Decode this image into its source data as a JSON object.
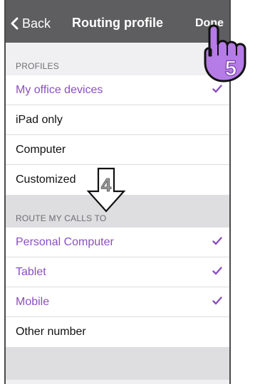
{
  "nav": {
    "back_label": "Back",
    "title": "Routing profile",
    "done_label": "Done"
  },
  "profiles": {
    "header": "PROFILES",
    "items": [
      {
        "label": "My office devices",
        "selected": true
      },
      {
        "label": "iPad only",
        "selected": false
      },
      {
        "label": "Computer",
        "selected": false
      },
      {
        "label": "Customized",
        "selected": false
      }
    ]
  },
  "route_calls": {
    "header": "ROUTE MY CALLS TO",
    "items": [
      {
        "label": "Personal Computer",
        "checked": true
      },
      {
        "label": "Tablet",
        "checked": true
      },
      {
        "label": "Mobile",
        "checked": true
      },
      {
        "label": "Other number",
        "checked": false
      }
    ]
  },
  "callouts": {
    "step_arrow": "4",
    "step_hand": "5"
  },
  "colors": {
    "navbar": "#5e5e60",
    "accent": "#8b4fc2",
    "callout_purple": "#b57be6"
  }
}
